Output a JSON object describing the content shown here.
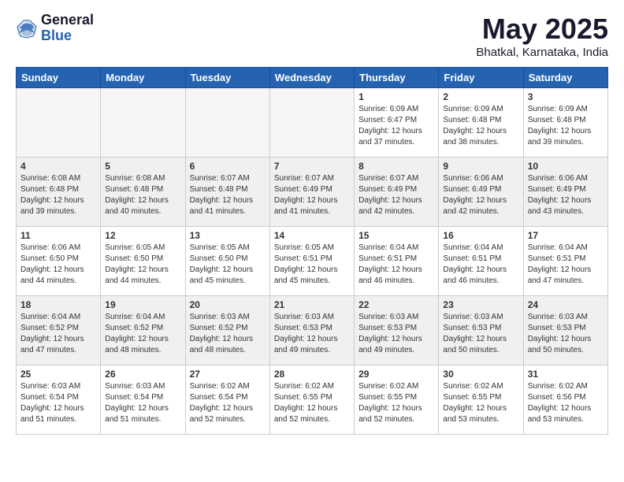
{
  "header": {
    "logo_general": "General",
    "logo_blue": "Blue",
    "title": "May 2025",
    "location": "Bhatkal, Karnataka, India"
  },
  "days_of_week": [
    "Sunday",
    "Monday",
    "Tuesday",
    "Wednesday",
    "Thursday",
    "Friday",
    "Saturday"
  ],
  "weeks": [
    {
      "days": [
        {
          "num": "",
          "empty": true
        },
        {
          "num": "",
          "empty": true
        },
        {
          "num": "",
          "empty": true
        },
        {
          "num": "",
          "empty": true
        },
        {
          "num": "1",
          "sunrise": "6:09 AM",
          "sunset": "6:47 PM",
          "daylight": "12 hours and 37 minutes."
        },
        {
          "num": "2",
          "sunrise": "6:09 AM",
          "sunset": "6:48 PM",
          "daylight": "12 hours and 38 minutes."
        },
        {
          "num": "3",
          "sunrise": "6:09 AM",
          "sunset": "6:48 PM",
          "daylight": "12 hours and 39 minutes."
        }
      ]
    },
    {
      "days": [
        {
          "num": "4",
          "sunrise": "6:08 AM",
          "sunset": "6:48 PM",
          "daylight": "12 hours and 39 minutes."
        },
        {
          "num": "5",
          "sunrise": "6:08 AM",
          "sunset": "6:48 PM",
          "daylight": "12 hours and 40 minutes."
        },
        {
          "num": "6",
          "sunrise": "6:07 AM",
          "sunset": "6:48 PM",
          "daylight": "12 hours and 41 minutes."
        },
        {
          "num": "7",
          "sunrise": "6:07 AM",
          "sunset": "6:49 PM",
          "daylight": "12 hours and 41 minutes."
        },
        {
          "num": "8",
          "sunrise": "6:07 AM",
          "sunset": "6:49 PM",
          "daylight": "12 hours and 42 minutes."
        },
        {
          "num": "9",
          "sunrise": "6:06 AM",
          "sunset": "6:49 PM",
          "daylight": "12 hours and 42 minutes."
        },
        {
          "num": "10",
          "sunrise": "6:06 AM",
          "sunset": "6:49 PM",
          "daylight": "12 hours and 43 minutes."
        }
      ]
    },
    {
      "days": [
        {
          "num": "11",
          "sunrise": "6:06 AM",
          "sunset": "6:50 PM",
          "daylight": "12 hours and 44 minutes."
        },
        {
          "num": "12",
          "sunrise": "6:05 AM",
          "sunset": "6:50 PM",
          "daylight": "12 hours and 44 minutes."
        },
        {
          "num": "13",
          "sunrise": "6:05 AM",
          "sunset": "6:50 PM",
          "daylight": "12 hours and 45 minutes."
        },
        {
          "num": "14",
          "sunrise": "6:05 AM",
          "sunset": "6:51 PM",
          "daylight": "12 hours and 45 minutes."
        },
        {
          "num": "15",
          "sunrise": "6:04 AM",
          "sunset": "6:51 PM",
          "daylight": "12 hours and 46 minutes."
        },
        {
          "num": "16",
          "sunrise": "6:04 AM",
          "sunset": "6:51 PM",
          "daylight": "12 hours and 46 minutes."
        },
        {
          "num": "17",
          "sunrise": "6:04 AM",
          "sunset": "6:51 PM",
          "daylight": "12 hours and 47 minutes."
        }
      ]
    },
    {
      "days": [
        {
          "num": "18",
          "sunrise": "6:04 AM",
          "sunset": "6:52 PM",
          "daylight": "12 hours and 47 minutes."
        },
        {
          "num": "19",
          "sunrise": "6:04 AM",
          "sunset": "6:52 PM",
          "daylight": "12 hours and 48 minutes."
        },
        {
          "num": "20",
          "sunrise": "6:03 AM",
          "sunset": "6:52 PM",
          "daylight": "12 hours and 48 minutes."
        },
        {
          "num": "21",
          "sunrise": "6:03 AM",
          "sunset": "6:53 PM",
          "daylight": "12 hours and 49 minutes."
        },
        {
          "num": "22",
          "sunrise": "6:03 AM",
          "sunset": "6:53 PM",
          "daylight": "12 hours and 49 minutes."
        },
        {
          "num": "23",
          "sunrise": "6:03 AM",
          "sunset": "6:53 PM",
          "daylight": "12 hours and 50 minutes."
        },
        {
          "num": "24",
          "sunrise": "6:03 AM",
          "sunset": "6:53 PM",
          "daylight": "12 hours and 50 minutes."
        }
      ]
    },
    {
      "days": [
        {
          "num": "25",
          "sunrise": "6:03 AM",
          "sunset": "6:54 PM",
          "daylight": "12 hours and 51 minutes."
        },
        {
          "num": "26",
          "sunrise": "6:03 AM",
          "sunset": "6:54 PM",
          "daylight": "12 hours and 51 minutes."
        },
        {
          "num": "27",
          "sunrise": "6:02 AM",
          "sunset": "6:54 PM",
          "daylight": "12 hours and 52 minutes."
        },
        {
          "num": "28",
          "sunrise": "6:02 AM",
          "sunset": "6:55 PM",
          "daylight": "12 hours and 52 minutes."
        },
        {
          "num": "29",
          "sunrise": "6:02 AM",
          "sunset": "6:55 PM",
          "daylight": "12 hours and 52 minutes."
        },
        {
          "num": "30",
          "sunrise": "6:02 AM",
          "sunset": "6:55 PM",
          "daylight": "12 hours and 53 minutes."
        },
        {
          "num": "31",
          "sunrise": "6:02 AM",
          "sunset": "6:56 PM",
          "daylight": "12 hours and 53 minutes."
        }
      ]
    }
  ]
}
